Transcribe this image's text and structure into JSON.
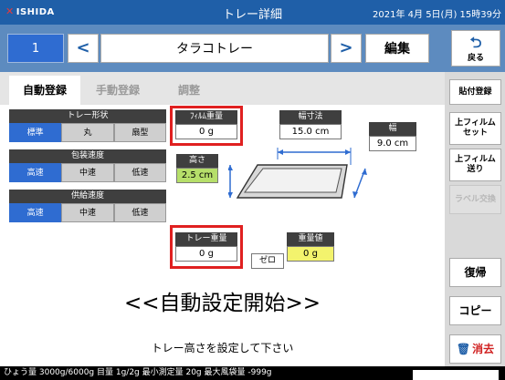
{
  "header": {
    "brand": "ISHIDA",
    "title": "トレー詳細",
    "datetime": "2021年 4月 5日(月) 15時39分"
  },
  "nav": {
    "number": "1",
    "prev": "<",
    "next": ">",
    "product_name": "タラコトレー",
    "edit_label": "編集",
    "back_label": "戻る"
  },
  "tabs": [
    "自動登録",
    "手動登録",
    "調整"
  ],
  "tray_shape": {
    "label": "トレー形状",
    "options": [
      "標準",
      "丸",
      "扇型"
    ],
    "selected": "標準"
  },
  "pack_speed": {
    "label": "包装速度",
    "options": [
      "高速",
      "中速",
      "低速"
    ],
    "selected": "高速"
  },
  "feed_speed": {
    "label": "供給速度",
    "options": [
      "高速",
      "中速",
      "低速"
    ],
    "selected": "高速"
  },
  "film_weight": {
    "label": "ﾌｨﾙﾑ重量",
    "value": "0 g"
  },
  "width_dim": {
    "label": "幅寸法",
    "value": "15.0 cm"
  },
  "width": {
    "label": "幅",
    "value": "9.0 cm"
  },
  "height": {
    "label": "高さ",
    "value": "2.5 cm"
  },
  "tray_weight": {
    "label": "トレー重量",
    "value": "0 g"
  },
  "zero_label": "ゼロ",
  "weight_value": {
    "label": "重量値",
    "value": "0 g"
  },
  "start_message": "<<自動設定開始>>",
  "instruction": "トレー高さを設定して下さい",
  "sidebar": {
    "attach": "貼付登録",
    "film_set": "上フィルム\nセット",
    "film_feed": "上フィルム\n送り",
    "label_change": "ラベル交換",
    "restore": "復帰",
    "copy": "コピー",
    "delete": "消去"
  },
  "status_bar": "ひょう量 3000g/6000g  目量 1g/2g  最小測定量 20g  最大風袋量 -999g",
  "colors": {
    "header": "#1f5fa8",
    "nav": "#5d8bbf",
    "selected": "#2f6cd1",
    "highlight": "#e02020"
  }
}
